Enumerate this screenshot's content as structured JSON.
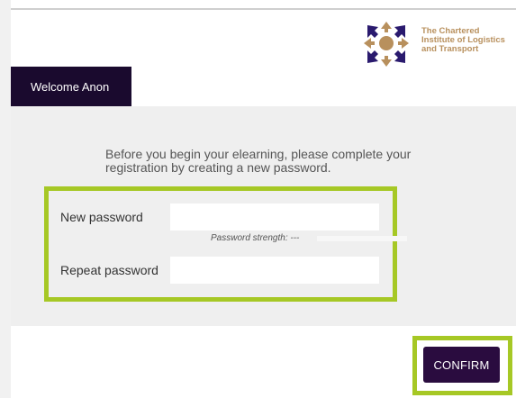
{
  "logo": {
    "text": "The Chartered\nInstitute of Logistics\nand Transport",
    "colors": {
      "gold": "#b8905d",
      "navy": "#2a1a6e"
    }
  },
  "welcome_tab": {
    "label": "Welcome Anon"
  },
  "intro": {
    "text": "Before you begin your elearning, please complete your registration by creating a new password."
  },
  "form": {
    "new_password_label": "New password",
    "new_password_value": "",
    "strength_text": "Password strength: ---",
    "repeat_password_label": "Repeat password",
    "repeat_password_value": ""
  },
  "confirm_button": {
    "label": "CONFIRM"
  },
  "colors": {
    "highlight": "#a6c825",
    "tab_bg": "#1a0a2e",
    "button_bg": "#2a0c3f",
    "panel_bg": "#efefef"
  }
}
